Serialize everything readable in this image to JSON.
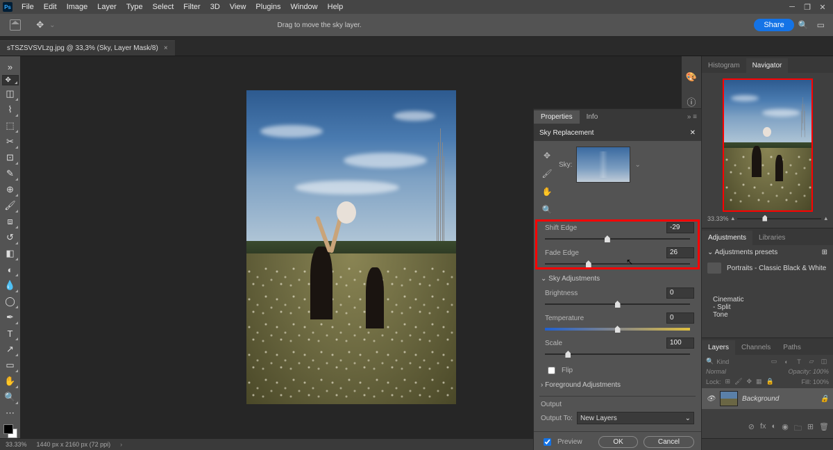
{
  "menu": [
    "File",
    "Edit",
    "Image",
    "Layer",
    "Type",
    "Select",
    "Filter",
    "3D",
    "View",
    "Plugins",
    "Window",
    "Help"
  ],
  "options_hint": "Drag to move the sky layer.",
  "share": "Share",
  "doc_tab": "sTSZSVSVLzg.jpg @ 33,3% (Sky, Layer Mask/8)",
  "dialog": {
    "props_tab": "Properties",
    "info_tab": "Info",
    "title": "Sky Replacement",
    "sky_label": "Sky:",
    "shift_edge": {
      "label": "Shift Edge",
      "value": "-29",
      "pos": 43
    },
    "fade_edge": {
      "label": "Fade Edge",
      "value": "26",
      "pos": 30
    },
    "section_sky": "Sky Adjustments",
    "brightness": {
      "label": "Brightness",
      "value": "0",
      "pos": 50
    },
    "temperature": {
      "label": "Temperature",
      "value": "0",
      "pos": 50
    },
    "scale": {
      "label": "Scale",
      "value": "100",
      "pos": 16
    },
    "flip": "Flip",
    "section_fg": "Foreground Adjustments",
    "output_hdr": "Output",
    "output_to": "Output To:",
    "output_val": "New Layers",
    "preview": "Preview",
    "ok": "OK",
    "cancel": "Cancel"
  },
  "right": {
    "histo": "Histogram",
    "nav": "Navigator",
    "zoom": "33.33%",
    "adj": "Adjustments",
    "lib": "Libraries",
    "presets_hdr": "Adjustments presets",
    "preset1": "Portraits - Classic Black  &  White",
    "preset2": "Cinematic - Split Tone",
    "layers": "Layers",
    "channels": "Channels",
    "paths": "Paths",
    "kind": "Kind",
    "blend": "Normal",
    "opacity_lbl": "Opacity:",
    "opacity": "100%",
    "lock_lbl": "Lock:",
    "fill_lbl": "Fill:",
    "fill": "100%",
    "bg_layer": "Background"
  },
  "status": {
    "zoom": "33.33%",
    "dims": "1440 px x 2160 px (72 ppi)"
  }
}
